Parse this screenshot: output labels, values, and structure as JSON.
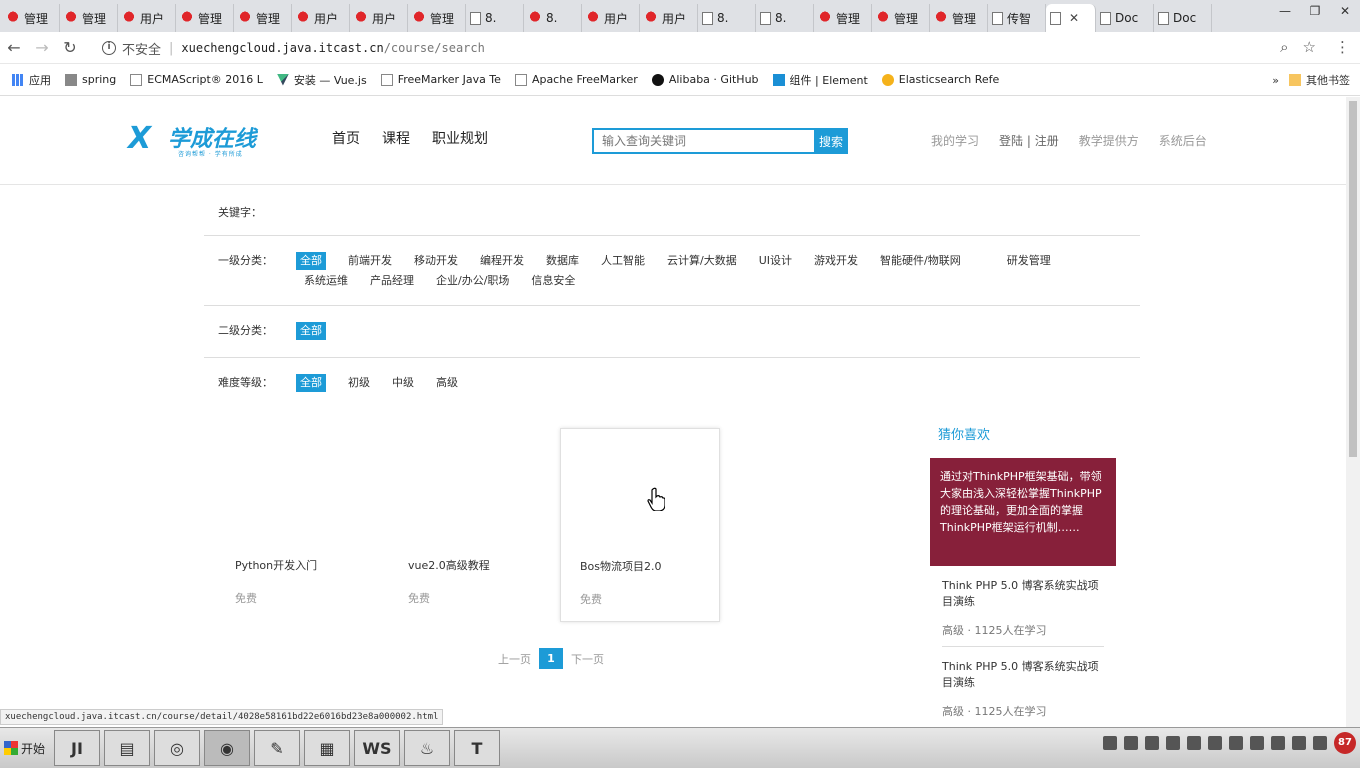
{
  "browser": {
    "tabs": [
      {
        "label": "管理",
        "icon": "huawei-icon"
      },
      {
        "label": "管理",
        "icon": "huawei-icon"
      },
      {
        "label": "用户",
        "icon": "huawei-icon"
      },
      {
        "label": "管理",
        "icon": "huawei-icon"
      },
      {
        "label": "管理",
        "icon": "huawei-icon"
      },
      {
        "label": "用户",
        "icon": "huawei-icon"
      },
      {
        "label": "用户",
        "icon": "huawei-icon"
      },
      {
        "label": "管理",
        "icon": "huawei-icon"
      },
      {
        "label": "8.",
        "icon": "doc-icon"
      },
      {
        "label": "8.",
        "icon": "huawei-icon"
      },
      {
        "label": "用户",
        "icon": "huawei-icon"
      },
      {
        "label": "用户",
        "icon": "huawei-icon"
      },
      {
        "label": "8.",
        "icon": "doc-icon"
      },
      {
        "label": "8.",
        "icon": "doc-icon"
      },
      {
        "label": "管理",
        "icon": "huawei-icon"
      },
      {
        "label": "管理",
        "icon": "huawei-icon"
      },
      {
        "label": "管理",
        "icon": "huawei-icon"
      },
      {
        "label": "传智",
        "icon": "doc-icon"
      },
      {
        "label": "",
        "icon": "doc-icon",
        "active": true
      },
      {
        "label": "Doc",
        "icon": "doc-icon"
      },
      {
        "label": "Doc",
        "icon": "doc-icon"
      }
    ],
    "security_label": "不安全",
    "url_host": "xuechengcloud.java.itcast.cn",
    "url_path": "/course/search",
    "bookmarks": [
      {
        "label": "应用",
        "icon": "grid"
      },
      {
        "label": "spring",
        "icon": "gray"
      },
      {
        "label": "ECMAScript® 2016 L",
        "icon": "page"
      },
      {
        "label": "安装 — Vue.js",
        "icon": "vue"
      },
      {
        "label": "FreeMarker Java Te",
        "icon": "page"
      },
      {
        "label": "Apache FreeMarker",
        "icon": "page"
      },
      {
        "label": "Alibaba · GitHub",
        "icon": "gh"
      },
      {
        "label": "组件 | Element",
        "icon": "cube"
      },
      {
        "label": "Elasticsearch Refe",
        "icon": "es"
      }
    ],
    "bookmarks_more": "»",
    "other_bookmarks": "其他书签",
    "status_url": "xuechengcloud.java.itcast.cn/course/detail/4028e58161bd22e6016bd23e8a000002.html"
  },
  "site": {
    "logo_mark": "X",
    "logo_name": "学成在线",
    "logo_slogan": "咨询帮帮 · 学有所成",
    "nav": [
      "首页",
      "课程",
      "职业规划"
    ],
    "search_placeholder": "输入查询关键词",
    "search_button": "搜索",
    "user_links": {
      "my_learning": "我的学习",
      "login": "登陆 | 注册",
      "provider": "教学提供方",
      "admin": "系统后台"
    }
  },
  "filters": {
    "keyword_label": "关键字：",
    "keyword_value": "",
    "level1_label": "一级分类：",
    "level1_items": [
      "全部",
      "前端开发",
      "移动开发",
      "编程开发",
      "数据库",
      "人工智能",
      "云计算/大数据",
      "UI设计",
      "游戏开发",
      "智能硬件/物联网",
      "研发管理",
      "系统运维",
      "产品经理",
      "企业/办公/职场",
      "信息安全"
    ],
    "level2_label": "二级分类：",
    "level2_items": [
      "全部"
    ],
    "difficulty_label": "难度等级：",
    "difficulty_items": [
      "全部",
      "初级",
      "中级",
      "高级"
    ]
  },
  "courses": [
    {
      "title": "Python开发入门",
      "price": "免费"
    },
    {
      "title": "vue2.0高级教程",
      "price": "免费"
    },
    {
      "title": "Bos物流项目2.0",
      "price": "免费"
    }
  ],
  "pagination": {
    "prev": "上一页",
    "current": "1",
    "next": "下一页"
  },
  "recommend": {
    "title": "猜你喜欢",
    "feature_text": "通过对ThinkPHP框架基础，带领大家由浅入深轻松掌握ThinkPHP的理论基础，更加全面的掌握ThinkPHP框架运行机制……",
    "feature_color": "#87203a",
    "items": [
      {
        "title": "Think PHP 5.0 博客系统实战项目演练",
        "meta": "高级 · 1125人在学习"
      },
      {
        "title": "Think PHP 5.0 博客系统实战项目演练",
        "meta": "高级 · 1125人在学习"
      }
    ]
  },
  "taskbar": {
    "start_label": "开始",
    "apps": [
      "JI",
      "▤",
      "◎",
      "◉",
      "✎",
      "▦",
      "WS",
      "♨",
      "T"
    ],
    "badge": "87"
  },
  "colors": {
    "accent": "#1d9bd7",
    "feature_bg": "#87203a"
  }
}
